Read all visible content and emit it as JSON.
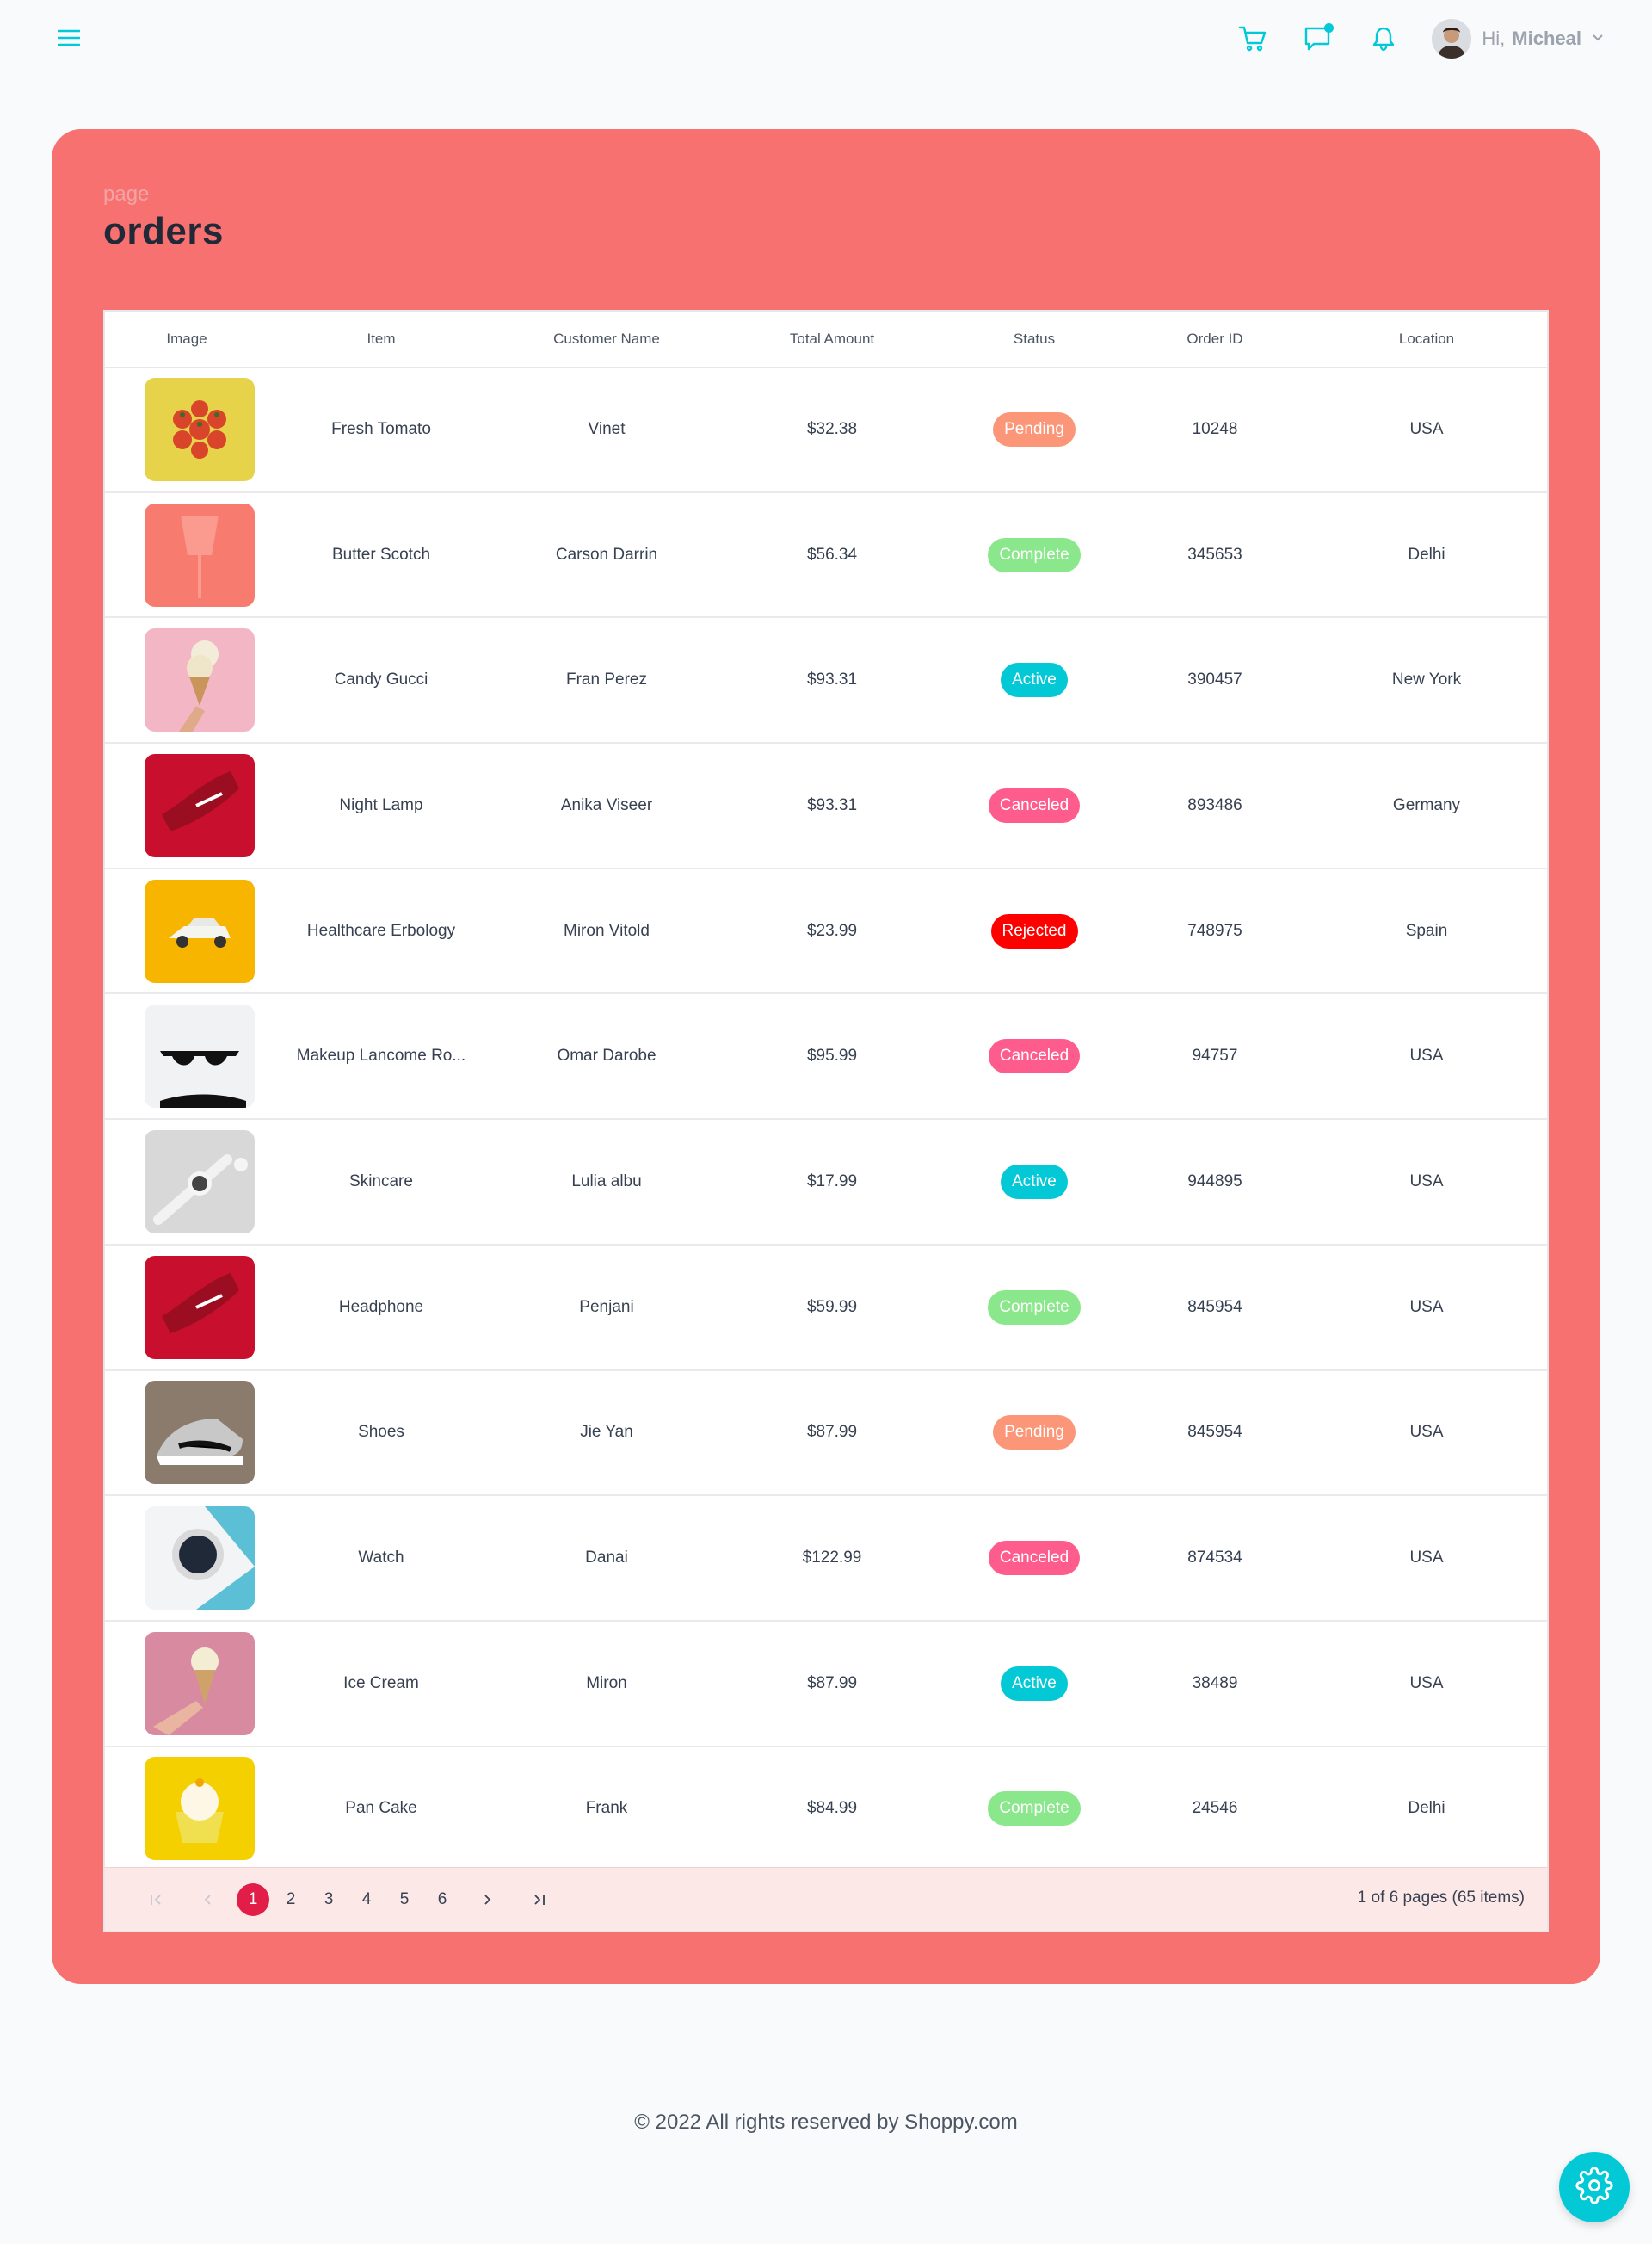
{
  "header": {
    "greeting": "Hi,",
    "user_name": "Micheal",
    "accent_color": "#03c9d7"
  },
  "page": {
    "label": "page",
    "title": "orders"
  },
  "table": {
    "columns": [
      "Image",
      "Item",
      "Customer Name",
      "Total Amount",
      "Status",
      "Order ID",
      "Location"
    ],
    "rows": [
      {
        "image": "fresh-tomato-image",
        "item": "Fresh Tomato",
        "customer": "Vinet",
        "amount": "$32.38",
        "status": "Pending",
        "order_id": "10248",
        "location": "USA"
      },
      {
        "image": "butter-scotch-image",
        "item": "Butter Scotch",
        "customer": "Carson Darrin",
        "amount": "$56.34",
        "status": "Complete",
        "order_id": "345653",
        "location": "Delhi"
      },
      {
        "image": "candy-gucci-image",
        "item": "Candy Gucci",
        "customer": "Fran Perez",
        "amount": "$93.31",
        "status": "Active",
        "order_id": "390457",
        "location": "New York"
      },
      {
        "image": "night-lamp-image",
        "item": "Night Lamp",
        "customer": "Anika Viseer",
        "amount": "$93.31",
        "status": "Canceled",
        "order_id": "893486",
        "location": "Germany"
      },
      {
        "image": "healthcare-erbology-image",
        "item": "Healthcare Erbology",
        "customer": "Miron Vitold",
        "amount": "$23.99",
        "status": "Rejected",
        "order_id": "748975",
        "location": "Spain"
      },
      {
        "image": "makeup-lancome-image",
        "item": "Makeup Lancome Ro...",
        "customer": "Omar Darobe",
        "amount": "$95.99",
        "status": "Canceled",
        "order_id": "94757",
        "location": "USA"
      },
      {
        "image": "skincare-image",
        "item": "Skincare",
        "customer": "Lulia albu",
        "amount": "$17.99",
        "status": "Active",
        "order_id": "944895",
        "location": "USA"
      },
      {
        "image": "headphone-image",
        "item": "Headphone",
        "customer": "Penjani",
        "amount": "$59.99",
        "status": "Complete",
        "order_id": "845954",
        "location": "USA"
      },
      {
        "image": "shoes-image",
        "item": "Shoes",
        "customer": "Jie Yan",
        "amount": "$87.99",
        "status": "Pending",
        "order_id": "845954",
        "location": "USA"
      },
      {
        "image": "watch-image",
        "item": "Watch",
        "customer": "Danai",
        "amount": "$122.99",
        "status": "Canceled",
        "order_id": "874534",
        "location": "USA"
      },
      {
        "image": "ice-cream-image",
        "item": "Ice Cream",
        "customer": "Miron",
        "amount": "$87.99",
        "status": "Active",
        "order_id": "38489",
        "location": "USA"
      },
      {
        "image": "pan-cake-image",
        "item": "Pan Cake",
        "customer": "Frank",
        "amount": "$84.99",
        "status": "Complete",
        "order_id": "24546",
        "location": "Delhi"
      }
    ],
    "status_colors": {
      "Pending": "#fb9678",
      "Complete": "#8be78b",
      "Active": "#03c9d7",
      "Canceled": "#ff5c8e",
      "Rejected": "#ff0000"
    }
  },
  "pager": {
    "pages": [
      "1",
      "2",
      "3",
      "4",
      "5",
      "6"
    ],
    "current_page": "1",
    "info": "1 of 6 pages (65 items)"
  },
  "footer": {
    "text": "© 2022 All rights reserved by Shoppy.com"
  }
}
